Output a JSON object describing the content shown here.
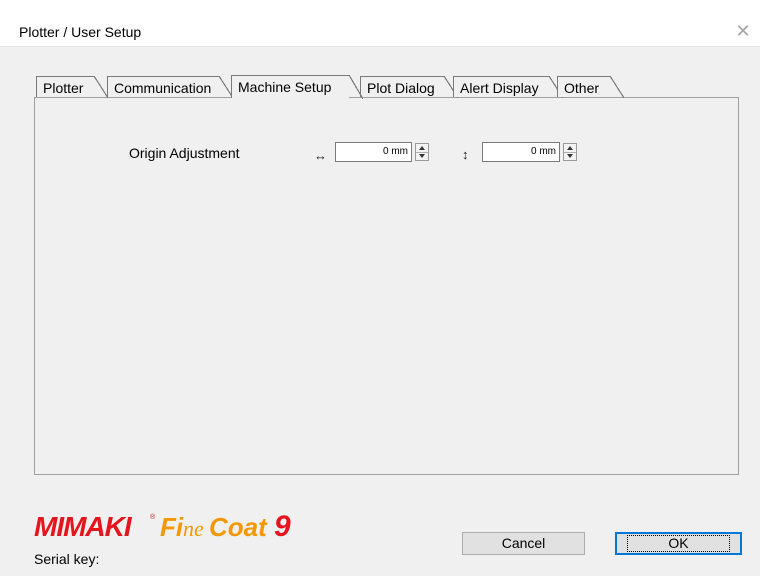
{
  "window": {
    "title": "Plotter / User Setup",
    "close_symbol": "✕"
  },
  "tabs": [
    {
      "label": "Plotter"
    },
    {
      "label": "Communication"
    },
    {
      "label": "Machine Setup",
      "active": true
    },
    {
      "label": "Plot Dialog"
    },
    {
      "label": "Alert Display"
    },
    {
      "label": "Other"
    }
  ],
  "machine_setup": {
    "origin_label": "Origin Adjustment",
    "horizontal": {
      "symbol": "↔",
      "value": "0 mm"
    },
    "vertical": {
      "symbol": "↕",
      "value": "0 mm"
    }
  },
  "brand": {
    "logo_text": "Mimaki FineCoat9",
    "logo_colors": [
      "#e5141d",
      "#f39800"
    ]
  },
  "footer": {
    "serial_label": "Serial key:",
    "cancel_label": "Cancel",
    "ok_label": "OK"
  }
}
